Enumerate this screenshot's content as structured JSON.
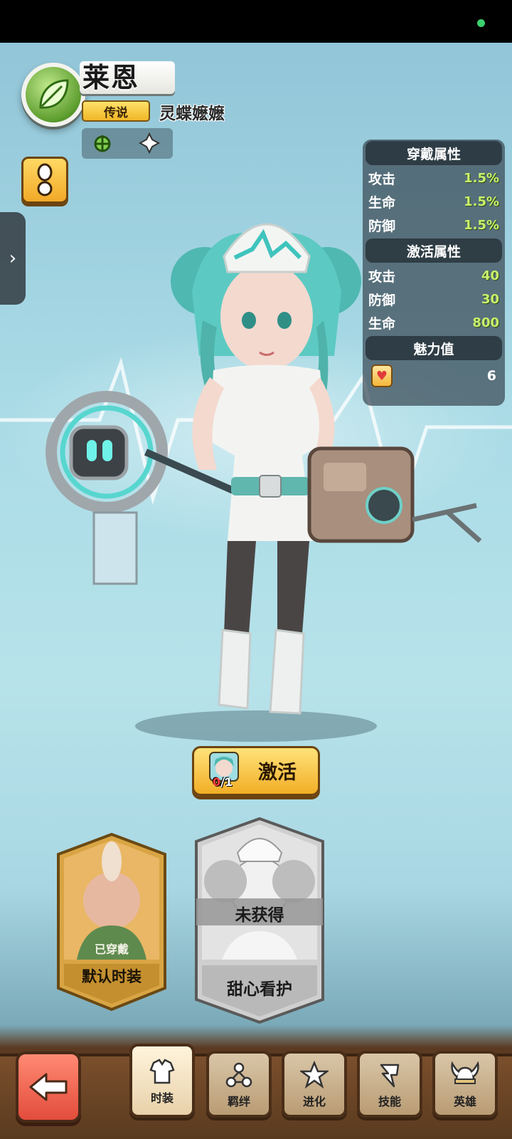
{
  "hero": {
    "name": "莱恩",
    "rarity": "传说",
    "title": "灵蝶嬷嬷",
    "traits": [
      "faction-icon",
      "class-icon"
    ]
  },
  "stats": {
    "wear_header": "穿戴属性",
    "wear": [
      {
        "label": "攻击",
        "value": "1.5%"
      },
      {
        "label": "生命",
        "value": "1.5%"
      },
      {
        "label": "防御",
        "value": "1.5%"
      }
    ],
    "active_header": "激活属性",
    "active": [
      {
        "label": "攻击",
        "value": "40"
      },
      {
        "label": "防御",
        "value": "30"
      },
      {
        "label": "生命",
        "value": "800"
      }
    ],
    "charm_header": "魅力值",
    "charm_value": "6"
  },
  "activate": {
    "label": "激活",
    "count_have": "0",
    "count_need": "/1"
  },
  "costumes": [
    {
      "name": "默认时装",
      "status": "已穿戴"
    },
    {
      "name": "甜心看护",
      "status": "未获得"
    }
  ],
  "nav": {
    "tabs": [
      {
        "label": "时装",
        "icon": "costume-icon",
        "active": true
      },
      {
        "label": "羁绊",
        "icon": "bond-icon",
        "active": false
      },
      {
        "label": "进化",
        "icon": "star-icon",
        "active": false
      },
      {
        "label": "技能",
        "icon": "skill-icon",
        "active": false
      },
      {
        "label": "英雄",
        "icon": "viking-helmet-icon",
        "active": false
      }
    ]
  },
  "colors": {
    "accent_gold": "#f2ae26",
    "stat_green": "#c9f06b",
    "back_red": "#e34c3b",
    "nurse_teal": "#3fc4bd"
  }
}
